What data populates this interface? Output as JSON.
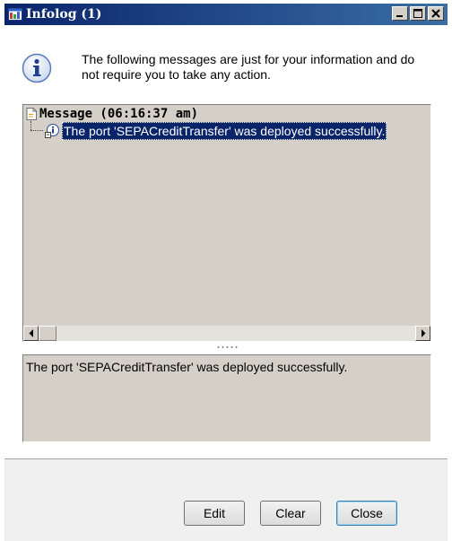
{
  "window": {
    "title": "Infolog (1)",
    "titlebar_color_start": "#0a246a",
    "titlebar_color_end": "#3a6ea5"
  },
  "intro": {
    "icon": "info-icon",
    "text": "The following messages are just for your information and do not require you to take any action."
  },
  "tree": {
    "header_icon": "document-icon",
    "header_label": "Message (06:16:37 am)",
    "items": [
      {
        "icon": "info-message-icon",
        "label": "The port 'SEPACreditTransfer' was deployed successfully.",
        "selected": true
      }
    ]
  },
  "detail": {
    "text": "The port 'SEPACreditTransfer' was deployed successfully."
  },
  "buttons": {
    "edit": "Edit",
    "clear": "Clear",
    "close": "Close"
  },
  "colors": {
    "selection": "#0a246a",
    "panel": "#d4d0c8"
  }
}
